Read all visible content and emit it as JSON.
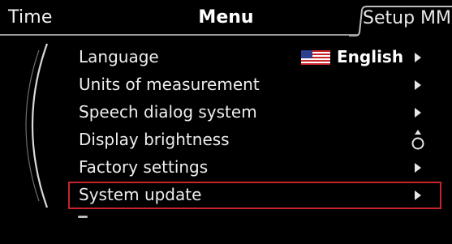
{
  "header": {
    "tab_left": "Time",
    "tab_center": "Menu",
    "tab_right": "Setup MMI"
  },
  "menu": {
    "items": [
      {
        "label": "Language",
        "control": "arrow",
        "value": "English",
        "flag_icon": "us-flag-icon"
      },
      {
        "label": "Units of measurement",
        "control": "arrow"
      },
      {
        "label": "Speech dialog system",
        "control": "arrow"
      },
      {
        "label": "Display brightness",
        "control": "slider"
      },
      {
        "label": "Factory settings",
        "control": "arrow"
      },
      {
        "label": "System update",
        "control": "arrow",
        "selected": true
      }
    ]
  },
  "colors": {
    "background": "#000000",
    "text": "#ededed",
    "selection_border": "#c8242a",
    "divider": "#9a9a9a"
  },
  "icons": {
    "submenu_arrow": "triangle-right-icon",
    "brightness_control": "rotary-slider-icon",
    "language_flag": "us-flag-icon"
  }
}
